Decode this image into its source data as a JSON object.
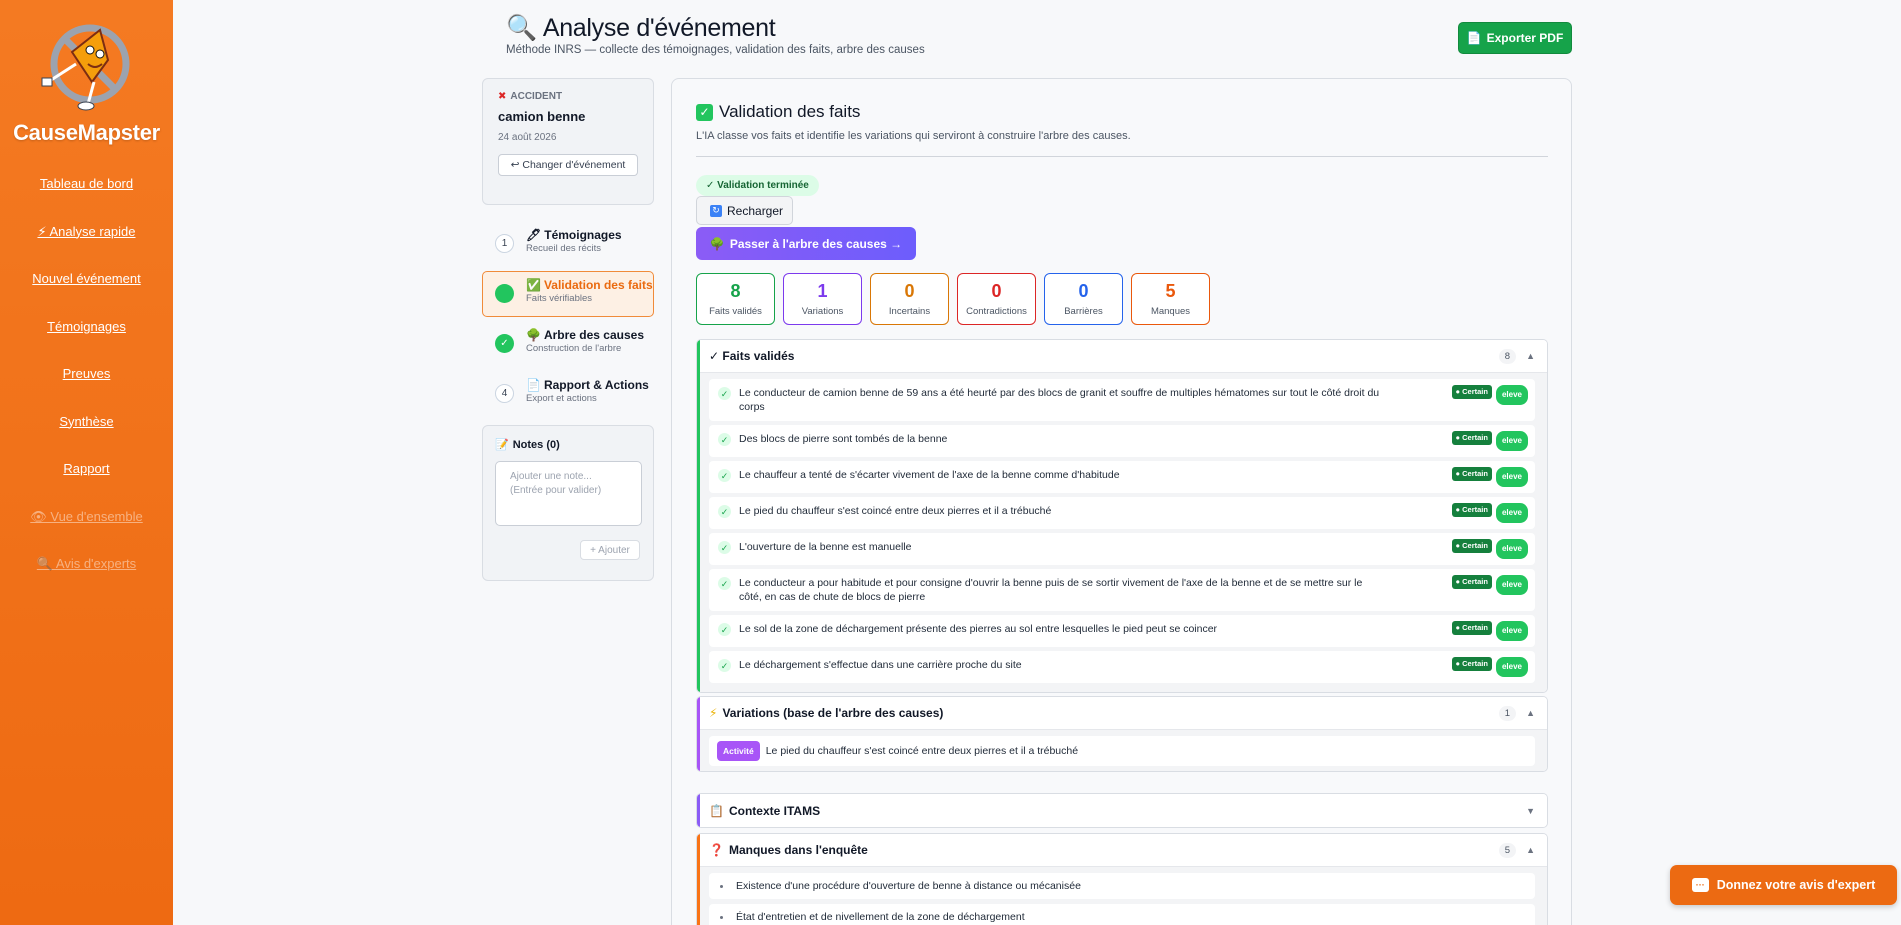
{
  "app": {
    "brand": "CauseMapster"
  },
  "nav": [
    "Tableau de bord",
    "⚡ Analyse rapide",
    "Nouvel événement",
    "Témoignages",
    "Preuves",
    "Synthèse",
    "Rapport",
    "👁 Vue d'ensemble",
    "🔍 Avis d'experts"
  ],
  "header": {
    "icon": "🔍",
    "title": "Analyse d'événement",
    "subtitle": "Méthode INRS — collecte des témoignages, validation des faits, arbre des causes",
    "export_label": "Exporter PDF"
  },
  "event": {
    "kind": "ACCIDENT",
    "title": "camion benne",
    "date": "24 août 2026",
    "change_label": "↩ Changer d'événement"
  },
  "steps": [
    {
      "marker": "1",
      "title": "Témoignages",
      "icon": "🖊",
      "desc": "Recueil des récits"
    },
    {
      "marker": "",
      "title": "Validation des faits",
      "icon": "✅",
      "desc": "Faits vérifiables"
    },
    {
      "marker": "✓",
      "title": "Arbre des causes",
      "icon": "🌳",
      "desc": "Construction de l'arbre"
    },
    {
      "marker": "4",
      "title": "Rapport & Actions",
      "icon": "📄",
      "desc": "Export et actions"
    }
  ],
  "notes": {
    "title": "Notes (0)",
    "placeholder": "Ajouter une note...\n(Entrée pour valider)",
    "add_label": "+ Ajouter"
  },
  "main": {
    "title": "Validation des faits",
    "subtitle": "L'IA classe vos faits et identifie les variations qui serviront à construire l'arbre des causes.",
    "status": "✓ Validation terminée",
    "reload_label": "Recharger",
    "next_label": "Passer à l'arbre des causes →"
  },
  "stats": [
    {
      "value": "8",
      "label": "Faits validés",
      "color": "#16a34a"
    },
    {
      "value": "1",
      "label": "Variations",
      "color": "#7c3aed"
    },
    {
      "value": "0",
      "label": "Incertains",
      "color": "#d97706"
    },
    {
      "value": "0",
      "label": "Contradictions",
      "color": "#dc2626"
    },
    {
      "value": "0",
      "label": "Barrières",
      "color": "#2563eb"
    },
    {
      "value": "5",
      "label": "Manques",
      "color": "#ea580c"
    }
  ],
  "sections": {
    "faits": {
      "title": "✓ Faits validés",
      "count": "8",
      "certain_label": "● Certain",
      "level_label": "eleve",
      "items": [
        "Le conducteur de camion benne de 59 ans a été heurté par des blocs de granit et souffre de multiples hématomes sur tout le côté droit du corps",
        "Des blocs de pierre sont tombés de la benne",
        "Le chauffeur a tenté de s'écarter vivement de l'axe de la benne comme d'habitude",
        "Le pied du chauffeur s'est coincé entre deux pierres et il a trébuché",
        "L'ouverture de la benne est manuelle",
        "Le conducteur a pour habitude et pour consigne d'ouvrir la benne puis de se sortir vivement de l'axe de la benne et de se mettre sur le côté, en cas de chute de blocs de pierre",
        "Le sol de la zone de déchargement présente des pierres au sol entre lesquelles le pied peut se coincer",
        "Le déchargement s'effectue dans une carrière proche du site"
      ]
    },
    "variations": {
      "title": "Variations (base de l'arbre des causes)",
      "count": "1",
      "tag": "Activité",
      "text": "Le pied du chauffeur s'est coincé entre deux pierres et il a trébuché"
    },
    "itams": {
      "title": "Contexte ITAMS"
    },
    "manques": {
      "title": "Manques dans l'enquête",
      "count": "5",
      "items": [
        "Existence d'une procédure d'ouverture de benne à distance ou mécanisée",
        "État d'entretien et de nivellement de la zone de déchargement"
      ]
    }
  },
  "feedback": {
    "label": "Donnez votre avis d'expert"
  }
}
